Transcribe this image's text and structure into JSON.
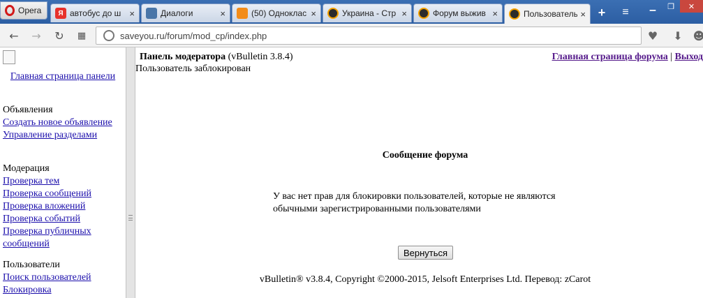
{
  "browser": {
    "menu_label": "Opera",
    "tabs": [
      {
        "title": "автобус до ш",
        "favicon": "yandex-icon"
      },
      {
        "title": "Диалоги",
        "favicon": "vk-icon"
      },
      {
        "title": "(50) Одноклас",
        "favicon": "odnoklassniki-icon"
      },
      {
        "title": "Украина - Стр",
        "favicon": "saveyou-icon"
      },
      {
        "title": "Форум выжив",
        "favicon": "saveyou-icon"
      },
      {
        "title": "Пользователь",
        "favicon": "saveyou-icon",
        "active": true
      }
    ],
    "close_glyph": "×",
    "new_tab_glyph": "+",
    "tab_menu_glyph": "≡",
    "url": "saveyou.ru/forum/mod_cp/index.php"
  },
  "sidebar": {
    "home_link": "Главная страница панели",
    "groups": [
      {
        "title": "Объявления",
        "links": [
          "Создать новое объявление",
          "Управление разделами"
        ]
      },
      {
        "title": "Модерация",
        "links": [
          "Проверка тем",
          "Проверка сообщений",
          "Проверка вложений",
          "Проверка событий",
          "Проверка публичных сообщений"
        ]
      },
      {
        "title": "Пользователи",
        "links": [
          "Поиск пользователей",
          "Блокировка"
        ]
      }
    ]
  },
  "main": {
    "panel_title": "Панель модератора",
    "panel_version": "(vBulletin 3.8.4)",
    "forum_home_link": "Главная страница форума",
    "link_separator": "|",
    "logout_link": "Выход",
    "status": "Пользователь заблокирован",
    "message_title": "Сообщение форума",
    "message_body": "У вас нет прав для блокировки пользователей, которые не являются обычными зарегистрированными пользователями",
    "back_button": "Вернуться",
    "copyright": "vBulletin® v3.8.4, Copyright ©2000-2015, Jelsoft Enterprises Ltd. Перевод: zCarot"
  },
  "colors": {
    "link": "#1a0dab",
    "visited_link": "#551a8b",
    "tabstrip": "#2c5ea3"
  }
}
